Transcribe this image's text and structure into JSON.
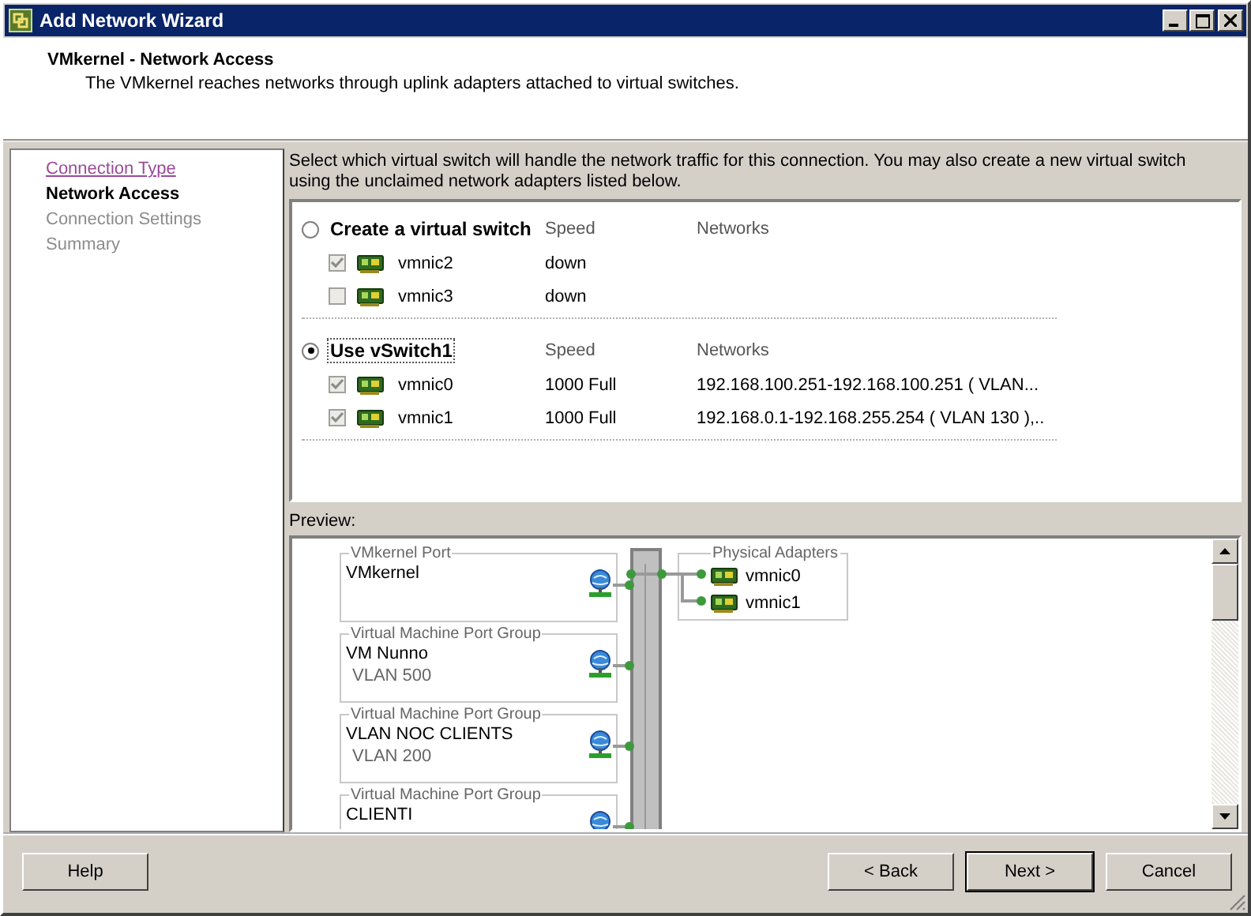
{
  "window": {
    "title": "Add Network Wizard"
  },
  "header": {
    "title": "VMkernel - Network Access",
    "subtitle": "The VMkernel reaches networks through uplink adapters attached to virtual switches."
  },
  "steps": [
    {
      "label": "Connection Type",
      "kind": "link"
    },
    {
      "label": "Network Access",
      "kind": "current"
    },
    {
      "label": "Connection Settings",
      "kind": "pending"
    },
    {
      "label": "Summary",
      "kind": "pending"
    }
  ],
  "instructions": "Select which virtual switch will handle the network traffic for this connection.  You may also create a new virtual switch using the unclaimed network adapters listed below.",
  "switch_options": [
    {
      "label": "Create a virtual switch",
      "selected": false,
      "speed_header": "Speed",
      "networks_header": "Networks",
      "adapters": [
        {
          "name": "vmnic2",
          "checked": true,
          "speed": "down"
        },
        {
          "name": "vmnic3",
          "checked": false,
          "speed": "down"
        }
      ]
    },
    {
      "label": "Use vSwitch1",
      "selected": true,
      "speed_header": "Speed",
      "networks_header": "Networks",
      "adapters": [
        {
          "name": "vmnic0",
          "checked": true,
          "speed": "1000 Full",
          "networks": "192.168.100.251-192.168.100.251 ( VLAN..."
        },
        {
          "name": "vmnic1",
          "checked": true,
          "speed": "1000 Full",
          "networks": "192.168.0.1-192.168.255.254 ( VLAN 130 ),.."
        }
      ]
    }
  ],
  "preview": {
    "label": "Preview:",
    "port_groups": [
      {
        "group_title": "VMkernel Port",
        "name": "VMkernel"
      },
      {
        "group_title": "Virtual Machine Port Group",
        "name": "VM Nunno",
        "vlan": "VLAN 500"
      },
      {
        "group_title": "Virtual Machine Port Group",
        "name": "VLAN NOC CLIENTS",
        "vlan": "VLAN 200"
      },
      {
        "group_title": "Virtual Machine Port Group",
        "name": "CLIENTI"
      }
    ],
    "physical_adapters": {
      "title": "Physical Adapters",
      "adapters": [
        "vmnic0",
        "vmnic1"
      ]
    }
  },
  "buttons": {
    "help": "Help",
    "back": "< Back",
    "next": "Next >",
    "cancel": "Cancel"
  }
}
